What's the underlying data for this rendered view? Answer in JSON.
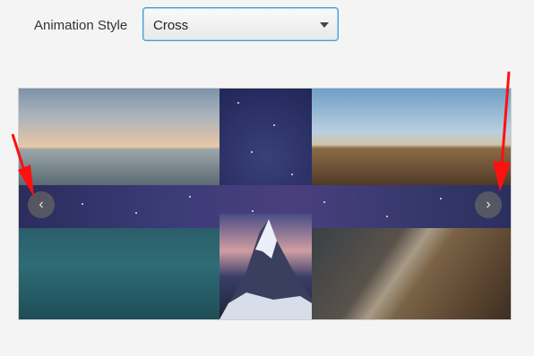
{
  "controls": {
    "animation_label": "Animation Style",
    "animation_value": "Cross"
  },
  "carousel": {
    "prev_glyph": "‹",
    "next_glyph": "›",
    "images": [
      "beach-sunset",
      "cliff-coast",
      "starry-sky",
      "teal-sea",
      "snowy-mountain",
      "rocky-shore"
    ]
  },
  "annotations": {
    "color": "#ff1010"
  }
}
